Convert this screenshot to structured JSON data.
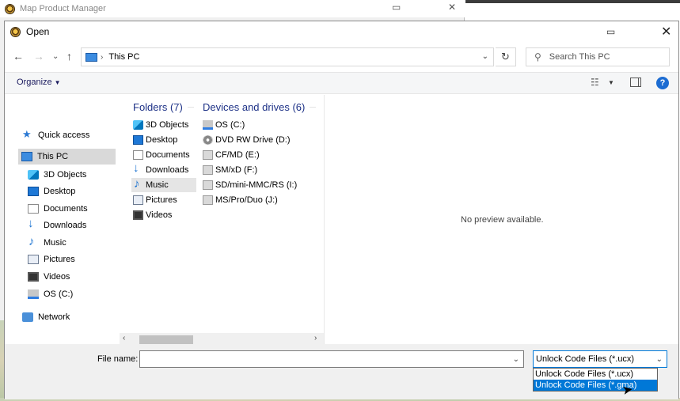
{
  "background_app": {
    "title": "Map Product Manager",
    "snap_icon": "snap-layout-icon",
    "close_glyph": "✕"
  },
  "dialog": {
    "title": "Open",
    "close_glyph": "✕"
  },
  "address": {
    "breadcrumb": "This PC",
    "search_placeholder": "Search This PC"
  },
  "toolbar": {
    "organize_label": "Organize",
    "help_label": "?"
  },
  "nav": {
    "items": [
      {
        "label": "Quick access",
        "icon": "star-icon"
      },
      {
        "label": "This PC",
        "icon": "pc-icon",
        "selected": true
      },
      {
        "label": "3D Objects",
        "icon": "3d-objects-icon"
      },
      {
        "label": "Desktop",
        "icon": "desktop-icon"
      },
      {
        "label": "Documents",
        "icon": "documents-icon"
      },
      {
        "label": "Downloads",
        "icon": "downloads-icon"
      },
      {
        "label": "Music",
        "icon": "music-icon"
      },
      {
        "label": "Pictures",
        "icon": "pictures-icon"
      },
      {
        "label": "Videos",
        "icon": "videos-icon"
      },
      {
        "label": "OS (C:)",
        "icon": "drive-icon"
      },
      {
        "label": "Network",
        "icon": "network-icon"
      }
    ]
  },
  "content": {
    "folders_header": "Folders (7)",
    "devices_header": "Devices and drives (6)",
    "folders": [
      "3D Objects",
      "Desktop",
      "Documents",
      "Downloads",
      "Music",
      "Pictures",
      "Videos"
    ],
    "drives": [
      "OS (C:)",
      "DVD RW Drive (D:)",
      "CF/MD (E:)",
      "SM/xD (F:)",
      "SD/mini-MMC/RS (I:)",
      "MS/Pro/Duo (J:)"
    ],
    "selected_folder": "Music"
  },
  "preview": {
    "text": "No preview available."
  },
  "bottom": {
    "filename_label": "File name:",
    "filename_value": "",
    "filetype_selected": "Unlock Code Files (*.ucx)",
    "filetype_options": [
      "Unlock Code Files (*.ucx)",
      "Unlock Code Files (*.gma)"
    ],
    "highlighted_option": "Unlock Code Files (*.gma)"
  },
  "colors": {
    "accent": "#0078d7",
    "header_blue": "#1e3287",
    "help_blue": "#1c6cd2"
  }
}
